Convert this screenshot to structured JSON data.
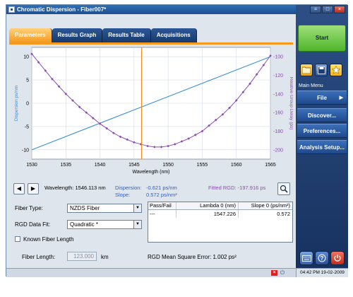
{
  "window": {
    "title": "Chromatic Dispersion - Fiber007*",
    "controls": [
      "=",
      "□",
      "×"
    ]
  },
  "tabs": [
    {
      "label": "Parameters",
      "active": true
    },
    {
      "label": "Results Graph",
      "active": false
    },
    {
      "label": "Results Table",
      "active": false
    },
    {
      "label": "Acquisitions",
      "active": false
    }
  ],
  "right_panel": {
    "start_label": "Start",
    "main_menu_label": "Main Menu",
    "menu": [
      {
        "label": "File",
        "arrow": "▶"
      },
      {
        "label": "Discover...",
        "arrow": ""
      },
      {
        "label": "Preferences...",
        "arrow": ""
      },
      {
        "label": "Analysis Setup...",
        "arrow": ""
      }
    ],
    "quick_icons": [
      "folder-icon",
      "save-icon",
      "star-icon"
    ],
    "bottom_icons": [
      "keyboard-icon",
      "help-icon",
      "power-icon"
    ]
  },
  "readouts": {
    "prev": "◀",
    "next": "▶",
    "wavelength_text": "Wavelength: 1546.113 nm",
    "dispersion_label": "Dispersion:",
    "dispersion_value": "-0.621 ps/nm",
    "slope_label": "Slope:",
    "slope_value": "0.572 ps/nm²",
    "fitted_rgd_text": "Fitted RGD: -197.916 ps"
  },
  "form": {
    "fiber_type_label": "Fiber Type:",
    "fiber_type_value": "NZDS Fiber",
    "rgd_fit_label": "RGD Data Fit:",
    "rgd_fit_value": "Quadratic *",
    "known_length_label": "Known Fiber Length",
    "fiber_length_label": "Fiber Length:",
    "fiber_length_value": "123.000",
    "fiber_length_unit": "km",
    "rgd_mse_text": "RGD Mean Square Error:  1.002 ps²"
  },
  "results_table": {
    "headers": [
      "Pass/Fail",
      "Lambda 0 (nm)",
      "Slope 0 (ps/nm²)"
    ],
    "rows": [
      [
        "---",
        "1547.226",
        "0.572"
      ]
    ]
  },
  "status": {
    "clock": "04:42 PM 19-02-2009"
  },
  "colors": {
    "dispersion_line": "#3c8fd0",
    "rgd_curve": "#8a4bb1",
    "cursor": "#f08a24",
    "active_tab": "#f59a1e",
    "start_button": "#5cc03a"
  },
  "chart_data": {
    "type": "line",
    "xlabel": "Wavelength (nm)",
    "ylabel_left": "Dispersion ps/nm",
    "ylabel_right": "Relative Group Delay (ps)",
    "xlim": [
      1530,
      1565
    ],
    "ylim_left": [
      -12,
      12
    ],
    "ylim_right": [
      -210,
      -90
    ],
    "x_ticks": [
      "1530",
      "1535",
      "1540",
      "1545",
      "1550",
      "1555",
      "1560",
      "1565"
    ],
    "y_ticks_left": [
      "10",
      "5",
      "0",
      "-5",
      "-10"
    ],
    "y_ticks_right": [
      "-100",
      "-120",
      "-140",
      "-160",
      "-180",
      "-200"
    ],
    "cursor_x": 1546.113,
    "series": [
      {
        "axis": "left",
        "style": "line",
        "x": [
          1530,
          1565
        ],
        "y": [
          -10,
          10
        ]
      },
      {
        "axis": "right",
        "style": "line+points",
        "x": [
          1530,
          1531,
          1532,
          1533,
          1534,
          1535,
          1536,
          1537,
          1538,
          1539,
          1540,
          1541,
          1542,
          1543,
          1544,
          1545,
          1546,
          1547,
          1548,
          1549,
          1550,
          1551,
          1552,
          1553,
          1554,
          1555,
          1556,
          1557,
          1558,
          1559,
          1560,
          1561,
          1562,
          1563,
          1564,
          1565
        ],
        "y": [
          -97,
          -106,
          -115,
          -124,
          -132,
          -140,
          -147,
          -154,
          -160,
          -166,
          -172,
          -177,
          -182,
          -186,
          -189,
          -192,
          -194,
          -196,
          -197,
          -197,
          -196,
          -194,
          -191,
          -188,
          -184,
          -180,
          -174,
          -168,
          -162,
          -155,
          -147,
          -138,
          -129,
          -119,
          -109,
          -99
        ]
      }
    ]
  }
}
